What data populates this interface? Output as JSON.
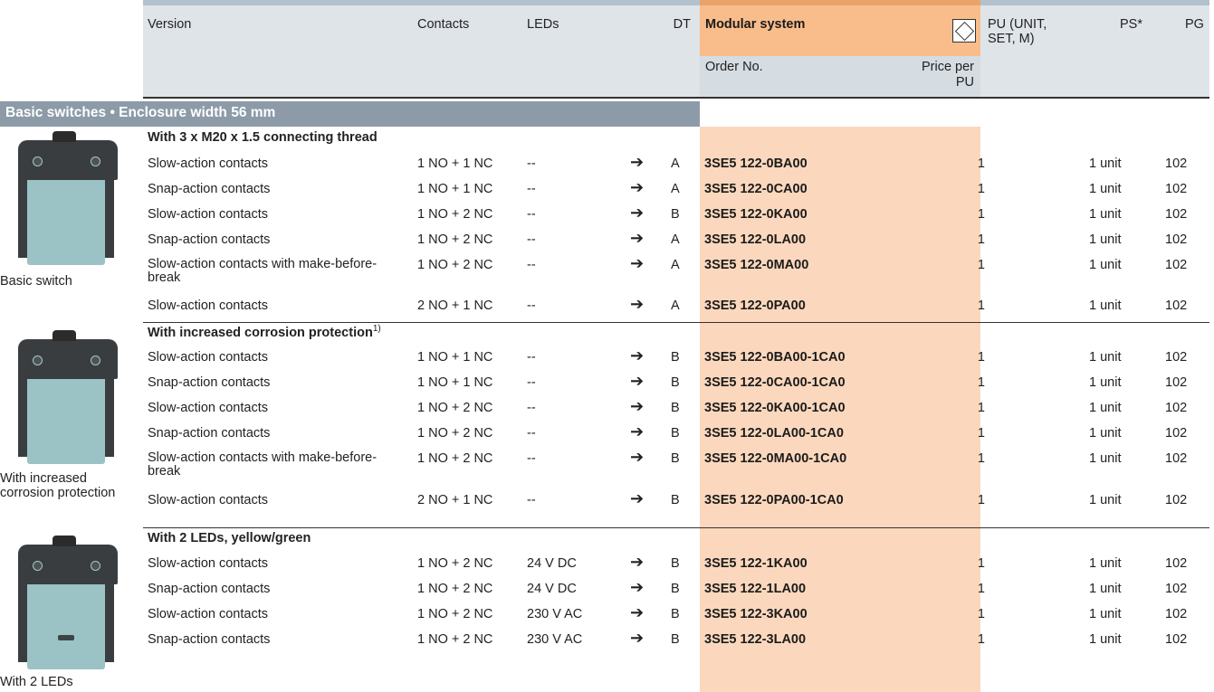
{
  "header": {
    "version": "Version",
    "contacts": "Contacts",
    "leds": "LEDs",
    "dt": "DT",
    "modular_system": "Modular system",
    "pu": "PU (UNIT, SET, M)",
    "ps": "PS*",
    "pg": "PG",
    "order_no": "Order No.",
    "price": "Price per PU"
  },
  "icons": {
    "modular": "diamond-in-square-icon",
    "arrow": "circle-arrow-right-icon"
  },
  "section_title": "Basic switches • Enclosure width 56 mm",
  "groups": [
    {
      "title": "With 3 x M20 x 1.5 connecting thread",
      "note": "",
      "caption": "Basic switch",
      "rows": [
        {
          "version": "Slow-action contacts",
          "contacts": "1 NO + 1 NC",
          "leds": "--",
          "arrow": "➔",
          "dt": "A",
          "order": "3SE5 122-0BA00",
          "pu": "1",
          "ps": "1 unit",
          "pg": "102"
        },
        {
          "version": "Snap-action contacts",
          "contacts": "1 NO + 1 NC",
          "leds": "--",
          "arrow": "➔",
          "dt": "A",
          "order": "3SE5 122-0CA00",
          "pu": "1",
          "ps": "1 unit",
          "pg": "102"
        },
        {
          "version": "Slow-action contacts",
          "contacts": "1 NO + 2 NC",
          "leds": "--",
          "arrow": "➔",
          "dt": "B",
          "order": "3SE5 122-0KA00",
          "pu": "1",
          "ps": "1 unit",
          "pg": "102"
        },
        {
          "version": "Snap-action contacts",
          "contacts": "1 NO + 2 NC",
          "leds": "--",
          "arrow": "➔",
          "dt": "A",
          "order": "3SE5 122-0LA00",
          "pu": "1",
          "ps": "1 unit",
          "pg": "102"
        },
        {
          "version": "Slow-action contacts with make-before-break",
          "contacts": "1 NO + 2 NC",
          "leds": "--",
          "arrow": "➔",
          "dt": "A",
          "order": "3SE5 122-0MA00",
          "pu": "1",
          "ps": "1 unit",
          "pg": "102"
        },
        {
          "version": "Slow-action contacts",
          "contacts": "2 NO + 1 NC",
          "leds": "--",
          "arrow": "➔",
          "dt": "A",
          "order": "3SE5 122-0PA00",
          "pu": "1",
          "ps": "1 unit",
          "pg": "102"
        }
      ]
    },
    {
      "title": "With increased corrosion protection",
      "note": "1)",
      "caption": "With increased corrosion protection",
      "rows": [
        {
          "version": "Slow-action contacts",
          "contacts": "1 NO + 1 NC",
          "leds": "--",
          "arrow": "➔",
          "dt": "B",
          "order": "3SE5 122-0BA00-1CA0",
          "pu": "1",
          "ps": "1 unit",
          "pg": "102"
        },
        {
          "version": "Snap-action contacts",
          "contacts": "1 NO + 1 NC",
          "leds": "--",
          "arrow": "➔",
          "dt": "B",
          "order": "3SE5 122-0CA00-1CA0",
          "pu": "1",
          "ps": "1 unit",
          "pg": "102"
        },
        {
          "version": "Slow-action contacts",
          "contacts": "1 NO + 2 NC",
          "leds": "--",
          "arrow": "➔",
          "dt": "B",
          "order": "3SE5 122-0KA00-1CA0",
          "pu": "1",
          "ps": "1 unit",
          "pg": "102"
        },
        {
          "version": "Snap-action contacts",
          "contacts": "1 NO + 2 NC",
          "leds": "--",
          "arrow": "➔",
          "dt": "B",
          "order": "3SE5 122-0LA00-1CA0",
          "pu": "1",
          "ps": "1 unit",
          "pg": "102"
        },
        {
          "version": "Slow-action contacts with make-before-break",
          "contacts": "1 NO + 2 NC",
          "leds": "--",
          "arrow": "➔",
          "dt": "B",
          "order": "3SE5 122-0MA00-1CA0",
          "pu": "1",
          "ps": "1 unit",
          "pg": "102"
        },
        {
          "version": "Slow-action contacts",
          "contacts": "2 NO + 1 NC",
          "leds": "--",
          "arrow": "➔",
          "dt": "B",
          "order": "3SE5 122-0PA00-1CA0",
          "pu": "1",
          "ps": "1 unit",
          "pg": "102"
        }
      ]
    },
    {
      "title": "With 2 LEDs, yellow/green",
      "note": "",
      "caption": "With 2 LEDs",
      "rows": [
        {
          "version": "Slow-action contacts",
          "contacts": "1 NO + 2 NC",
          "leds": "24 V DC",
          "arrow": "➔",
          "dt": "B",
          "order": "3SE5 122-1KA00",
          "pu": "1",
          "ps": "1 unit",
          "pg": "102"
        },
        {
          "version": "Snap-action contacts",
          "contacts": "1 NO + 2 NC",
          "leds": "24 V DC",
          "arrow": "➔",
          "dt": "B",
          "order": "3SE5 122-1LA00",
          "pu": "1",
          "ps": "1 unit",
          "pg": "102"
        },
        {
          "version": "Slow-action contacts",
          "contacts": "1 NO + 2 NC",
          "leds": "230 V AC",
          "arrow": "➔",
          "dt": "B",
          "order": "3SE5 122-3KA00",
          "pu": "1",
          "ps": "1 unit",
          "pg": "102"
        },
        {
          "version": "Snap-action contacts",
          "contacts": "1 NO + 2 NC",
          "leds": "230 V AC",
          "arrow": "➔",
          "dt": "B",
          "order": "3SE5 122-3LA00",
          "pu": "1",
          "ps": "1 unit",
          "pg": "102"
        }
      ]
    }
  ]
}
